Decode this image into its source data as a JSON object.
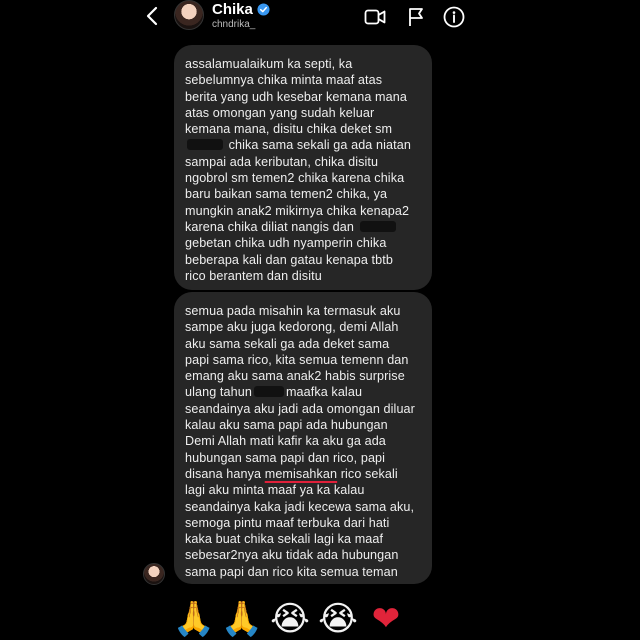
{
  "header": {
    "name": "Chika",
    "username": "chndrika_",
    "verified_color": "#3897f0",
    "icons": [
      "back-icon",
      "video-call-icon",
      "flag-icon",
      "info-icon"
    ]
  },
  "message1": {
    "lines": [
      "assalamualaikum ka septi, ka",
      "sebelumnya chika minta maaf atas",
      "berita yang udh kesebar kemana mana",
      "atas omongan yang sudah keluar",
      "kemana mana, disitu chika deket sm",
      " chika sama sekali ga ada niatan",
      "sampai ada keributan, chika disitu",
      "ngobrol sm temen2 chika karena chika",
      "baru baikan sama temen2 chika, ya",
      "mungkin anak2 mikirnya chika kenapa2",
      "karena chika diliat nangis dan ",
      "gebetan chika udh nyamperin chika",
      "beberapa kali dan gatau kenapa tbtb",
      "rico berantem dan disitu"
    ]
  },
  "message2": {
    "lines_before": [
      "semua pada misahin ka termasuk aku",
      "sampe aku juga kedorong, demi Allah",
      "aku sama sekali ga ada deket sama",
      "papi sama rico, kita semua temenn dan",
      "emang aku sama anak2 habis surprise"
    ],
    "line_redacted_prefix": "ulang tahun",
    "line_redacted_suffix": "maafka kalau",
    "lines_middle": [
      "seandainya aku jadi ada omongan diluar",
      "kalau aku sama papi ada hubungan",
      "Demi Allah mati kafir ka aku ga ada",
      "hubungan sama papi dan rico, papi"
    ],
    "underline_prefix": "disana hanya ",
    "underline_word": "memisahkan",
    "underline_suffix": " rico sekali",
    "lines_after": [
      "lagi aku minta maaf ya ka kalau",
      "seandainya kaka jadi kecewa sama aku,",
      "semoga pintu maaf terbuka dari hati",
      "kaka buat chika sekali lagi ka maaf",
      "sebesar2nya aku tidak ada hubungan",
      "sama papi dan rico kita semua teman"
    ]
  },
  "reactions": [
    "🙏",
    "🙏",
    "😭",
    "😭",
    "❤"
  ]
}
